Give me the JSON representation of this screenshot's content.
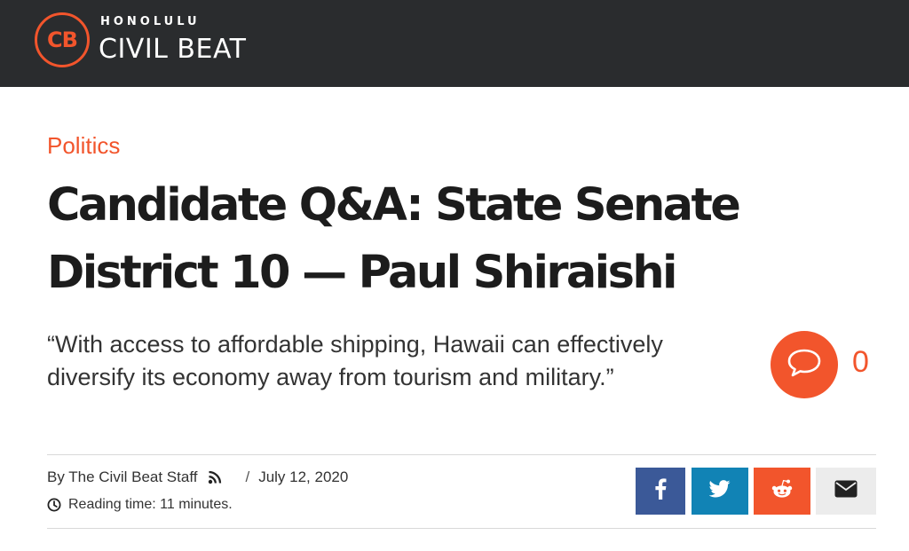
{
  "header": {
    "logo_initials": "CB",
    "logo_kicker": "HONOLULU",
    "logo_name": "CIVIL BEAT"
  },
  "article": {
    "category": "Politics",
    "headline": "Candidate Q&A: State Senate District 10 — Paul Shiraishi",
    "dek": "“With access to affordable shipping, Hawaii can effectively diversify its economy away from tourism and military.”",
    "comment_count": "0",
    "byline_author": "By The Civil Beat Staff",
    "byline_separator": "/",
    "date": "July 12, 2020",
    "reading_time": "Reading time: 11 minutes."
  },
  "share": {
    "buttons": [
      "facebook",
      "twitter",
      "reddit",
      "email"
    ]
  },
  "icons": {
    "comment": "speech-bubble-icon",
    "rss": "rss-icon",
    "clock": "clock-icon",
    "facebook": "facebook-icon",
    "twitter": "twitter-icon",
    "reddit": "reddit-icon",
    "email": "envelope-icon"
  },
  "colors": {
    "accent": "#f2552c",
    "header_bg": "#2a2c2e",
    "facebook": "#3b5998",
    "twitter": "#1183b5",
    "reddit": "#f2552c",
    "email_bg": "#ececec"
  }
}
